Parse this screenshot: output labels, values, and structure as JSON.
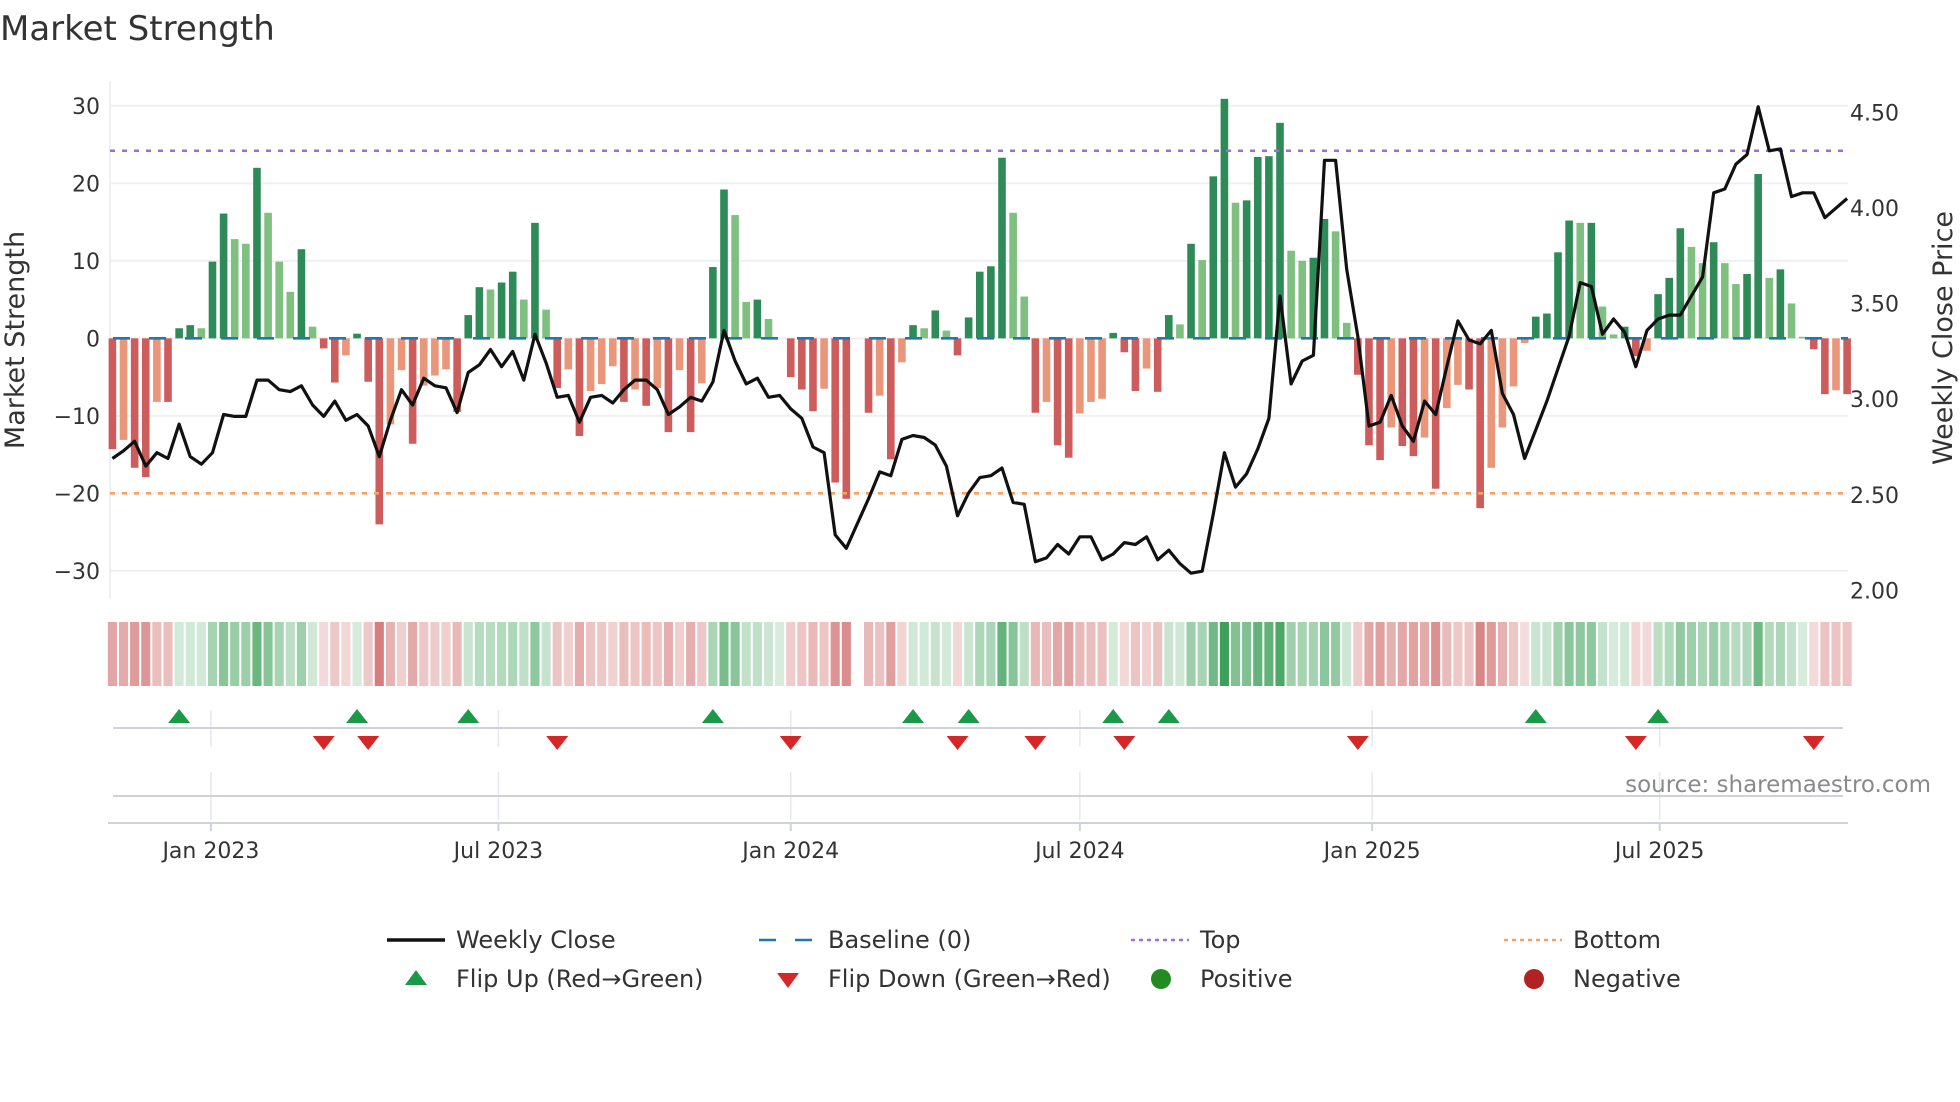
{
  "chart_data": {
    "type": "bar",
    "title": "Market Strength",
    "ylabel": "Market Strength",
    "y2label": "Weekly Close Price",
    "ylim": [
      -33.5,
      33.2
    ],
    "y2lim": [
      1.96,
      4.665
    ],
    "yticks": [
      "30",
      "20",
      "10",
      "0",
      "−10",
      "−20",
      "−30"
    ],
    "ytick_values": [
      30,
      20,
      10,
      0,
      -10,
      -20,
      -30
    ],
    "y2ticks": [
      "4.50",
      "4.00",
      "3.50",
      "3.00",
      "2.50",
      "2.00"
    ],
    "y2tick_values": [
      4.5,
      4.0,
      3.5,
      3.0,
      2.5,
      2.0
    ],
    "x_start_date": "2022-10-31",
    "x_step_days": 7,
    "xticks": [
      {
        "label": "Jan 2023",
        "date": "2023-01-01"
      },
      {
        "label": "Jul 2023",
        "date": "2023-07-01"
      },
      {
        "label": "Jan 2024",
        "date": "2024-01-01"
      },
      {
        "label": "Jul 2024",
        "date": "2024-07-01"
      },
      {
        "label": "Jan 2025",
        "date": "2025-01-01"
      },
      {
        "label": "Jul 2025",
        "date": "2025-07-01"
      }
    ],
    "top_level": 24.2,
    "bottom_level": -20,
    "baseline": 0,
    "strength": [
      -14.3,
      -13.1,
      -16.7,
      -17.9,
      -8.2,
      -8.2,
      1.3,
      1.7,
      1.3,
      9.9,
      16.1,
      12.8,
      12.2,
      22,
      16.2,
      9.9,
      6,
      11.5,
      1.5,
      -1.3,
      -5.7,
      -2.2,
      0.6,
      -5.6,
      -24,
      -11.1,
      -4.1,
      -13.6,
      -6.1,
      -4.8,
      -4,
      -9.5,
      3,
      6.6,
      6.3,
      7.2,
      8.6,
      5,
      14.9,
      3.7,
      -6.4,
      -4,
      -12.6,
      -6.8,
      -5.9,
      -3.6,
      -8.2,
      -6.6,
      -8.7,
      -6.4,
      -12.1,
      -4.1,
      -12.1,
      -5.8,
      9.2,
      19.2,
      15.9,
      4.7,
      5,
      2.5,
      0,
      -5,
      -6.6,
      -9.4,
      -6.5,
      -18.6,
      -20.7,
      null,
      -9.6,
      -7.4,
      -15.6,
      -3.1,
      1.7,
      1.3,
      3.6,
      1,
      -2.2,
      2.7,
      8.6,
      9.3,
      23.3,
      16.2,
      5.4,
      -9.6,
      -8.2,
      -13.8,
      -15.4,
      -9.7,
      -8.2,
      -7.8,
      0.7,
      -1.8,
      -6.8,
      -3.9,
      -6.9,
      3,
      1.8,
      12.2,
      10.1,
      20.9,
      30.9,
      17.5,
      17.8,
      23.4,
      23.5,
      27.8,
      11.3,
      10,
      10.4,
      15.4,
      13.8,
      2,
      -4.7,
      -13.8,
      -15.7,
      -11.5,
      -13.9,
      -15.2,
      -12.8,
      -19.4,
      -9,
      -6,
      -6.6,
      -21.9,
      -16.7,
      -11.5,
      -6.2,
      -0.6,
      2.8,
      3.2,
      11.1,
      15.2,
      14.9,
      14.9,
      4.1,
      0.5,
      1.5,
      -2.3,
      -1.6,
      5.7,
      7.8,
      14.2,
      11.8,
      9.7,
      12.4,
      9.7,
      7,
      8.3,
      21.2,
      7.8,
      8.9,
      4.5,
      0.2,
      -1.4,
      -7.2,
      -6.7,
      -7.2
    ],
    "weekly_close": [
      2.69,
      2.73,
      2.78,
      2.65,
      2.72,
      2.69,
      2.87,
      2.7,
      2.66,
      2.72,
      2.92,
      2.91,
      2.91,
      3.1,
      3.1,
      3.05,
      3.04,
      3.07,
      2.97,
      2.91,
      2.99,
      2.89,
      2.92,
      2.86,
      2.7,
      2.89,
      3.05,
      2.97,
      3.11,
      3.07,
      3.06,
      2.93,
      3.14,
      3.18,
      3.26,
      3.17,
      3.25,
      3.1,
      3.34,
      3.19,
      3.01,
      3.02,
      2.88,
      3.01,
      3.02,
      2.98,
      3.05,
      3.1,
      3.1,
      3.05,
      2.92,
      2.96,
      3.01,
      2.99,
      3.09,
      3.36,
      3.2,
      3.08,
      3.11,
      3.01,
      3.02,
      2.95,
      2.9,
      2.75,
      2.72,
      2.29,
      2.22,
      2.35,
      2.48,
      2.62,
      2.6,
      2.79,
      2.81,
      2.8,
      2.76,
      2.65,
      2.39,
      2.51,
      2.59,
      2.6,
      2.64,
      2.46,
      2.45,
      2.15,
      2.17,
      2.24,
      2.19,
      2.28,
      2.28,
      2.16,
      2.19,
      2.25,
      2.24,
      2.28,
      2.16,
      2.21,
      2.14,
      2.09,
      2.1,
      2.4,
      2.72,
      2.54,
      2.61,
      2.74,
      2.9,
      3.54,
      3.08,
      3.2,
      3.23,
      4.25,
      4.25,
      3.68,
      3.33,
      2.86,
      2.88,
      3.02,
      2.86,
      2.78,
      2.99,
      2.92,
      3.17,
      3.41,
      3.31,
      3.29,
      3.36,
      3.03,
      2.92,
      2.69,
      2.84,
      2.99,
      3.16,
      3.33,
      3.61,
      3.59,
      3.34,
      3.42,
      3.35,
      3.17,
      3.36,
      3.42,
      3.44,
      3.44,
      3.54,
      3.64,
      4.08,
      4.1,
      4.23,
      4.28,
      4.53,
      4.3,
      4.31,
      4.06,
      4.08,
      4.08,
      3.95,
      4.0,
      4.05
    ],
    "flip_up_weeks": [
      6,
      22,
      32,
      54,
      72,
      77,
      90,
      95,
      128,
      139
    ],
    "flip_down_weeks": [
      19,
      23,
      40,
      61,
      76,
      83,
      91,
      112,
      137,
      153
    ],
    "legend": {
      "placement": "bottom",
      "items": [
        {
          "key": "close",
          "label": "Weekly Close"
        },
        {
          "key": "baseline",
          "label": "Baseline (0)"
        },
        {
          "key": "top",
          "label": "Top"
        },
        {
          "key": "bottom",
          "label": "Bottom"
        },
        {
          "key": "flip_up",
          "label": "Flip Up (Red→Green)"
        },
        {
          "key": "flip_down",
          "label": "Flip Down (Green→Red)"
        },
        {
          "key": "positive",
          "label": "Positive"
        },
        {
          "key": "negative",
          "label": "Negative"
        }
      ]
    },
    "annotation": "source: sharemaestro.com"
  },
  "colors": {
    "pos_strong": "#2e8b57",
    "pos_weak": "#7fbf7f",
    "neg_strong": "#cd5c5c",
    "neg_weak": "#e9967a",
    "close": "#111111",
    "baseline": "#1f77b4",
    "top": "#9b6ee0",
    "bottom": "#f4a460",
    "flip_up": "#1a9a48",
    "flip_down": "#d62728",
    "positive": "#228b22",
    "negative": "#b22222"
  }
}
